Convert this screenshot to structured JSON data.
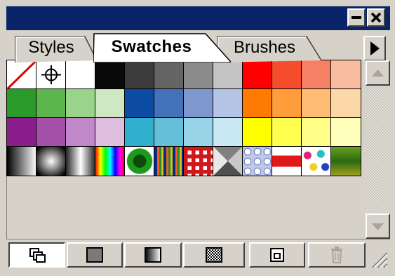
{
  "tabs": [
    {
      "label": "Styles",
      "active": false
    },
    {
      "label": "Swatches",
      "active": true
    },
    {
      "label": "Brushes",
      "active": false
    }
  ],
  "title_buttons": [
    "minimize-icon",
    "close-icon"
  ],
  "swatches": [
    [
      {
        "name": "None",
        "kind": "none"
      },
      {
        "name": "Registration",
        "kind": "registration"
      },
      {
        "name": "White",
        "color": "#ffffff"
      },
      {
        "name": "Black",
        "color": "#0a0a0a"
      },
      {
        "name": "75% Gray",
        "color": "#3c3c3c"
      },
      {
        "name": "60% Gray",
        "color": "#646464"
      },
      {
        "name": "45% Gray",
        "color": "#8c8c8c"
      },
      {
        "name": "25% Gray",
        "color": "#c4c4c4"
      },
      {
        "name": "Red",
        "color": "#ff0000"
      },
      {
        "name": "Orange Red",
        "color": "#f54c2c"
      },
      {
        "name": "Salmon",
        "color": "#f58064"
      },
      {
        "name": "Peach",
        "color": "#f9bca0"
      }
    ],
    [
      {
        "name": "Green",
        "color": "#2a9a2a"
      },
      {
        "name": "Medium Green",
        "color": "#5cb64c"
      },
      {
        "name": "Light Green",
        "color": "#9ad48a"
      },
      {
        "name": "Pale Green",
        "color": "#cfe8c4"
      },
      {
        "name": "Navy Blue",
        "color": "#0c4ca4"
      },
      {
        "name": "Medium Blue",
        "color": "#4472b8"
      },
      {
        "name": "Light Blue",
        "color": "#7c98cc"
      },
      {
        "name": "Pale Blue",
        "color": "#b4c4e4"
      },
      {
        "name": "Dark Orange",
        "color": "#ff7a00"
      },
      {
        "name": "Orange",
        "color": "#ff9c3c"
      },
      {
        "name": "Light Orange",
        "color": "#ffbc74"
      },
      {
        "name": "Pale Orange",
        "color": "#fcd8a8"
      }
    ],
    [
      {
        "name": "Purple",
        "color": "#8a1c8c"
      },
      {
        "name": "Medium Purple",
        "color": "#a450a8"
      },
      {
        "name": "Lavender",
        "color": "#c088c8"
      },
      {
        "name": "Pale Lavender",
        "color": "#e0bedf"
      },
      {
        "name": "Teal",
        "color": "#30b0cc"
      },
      {
        "name": "Sky",
        "color": "#64c0d8"
      },
      {
        "name": "Light Sky",
        "color": "#98d4e8"
      },
      {
        "name": "Pale Sky",
        "color": "#c8e8f4"
      },
      {
        "name": "Yellow",
        "color": "#ffff00"
      },
      {
        "name": "Light Yellow",
        "color": "#ffff50"
      },
      {
        "name": "Pale Yellow",
        "color": "#ffff88"
      },
      {
        "name": "Cream",
        "color": "#ffffbc"
      }
    ],
    [
      {
        "name": "Black White Linear",
        "kind": "gradient-linear"
      },
      {
        "name": "Black White Radial",
        "kind": "gradient-radial"
      },
      {
        "name": "Steel",
        "kind": "gradient-steel"
      },
      {
        "name": "Rainbow",
        "kind": "gradient-rainbow"
      },
      {
        "name": "Green Dot",
        "kind": "pattern-dot"
      },
      {
        "name": "Stripes Gradient",
        "kind": "gradient-stripes"
      },
      {
        "name": "Checker",
        "kind": "pattern-checker"
      },
      {
        "name": "Pyramid",
        "kind": "pattern-pyramid"
      },
      {
        "name": "Circles",
        "kind": "pattern-circles"
      },
      {
        "name": "Red Band",
        "kind": "pattern-band"
      },
      {
        "name": "Confetti",
        "kind": "pattern-confetti"
      },
      {
        "name": "Foliage",
        "kind": "pattern-foliage"
      }
    ]
  ],
  "bottom_buttons": [
    {
      "icon": "show-all-swatches-icon",
      "pressed": true
    },
    {
      "icon": "show-color-swatches-icon",
      "pressed": false
    },
    {
      "icon": "show-gradient-swatches-icon",
      "pressed": false
    },
    {
      "icon": "show-pattern-swatches-icon",
      "pressed": false
    },
    {
      "icon": "new-swatch-icon",
      "pressed": false
    },
    {
      "icon": "delete-swatch-icon",
      "pressed": false
    }
  ]
}
